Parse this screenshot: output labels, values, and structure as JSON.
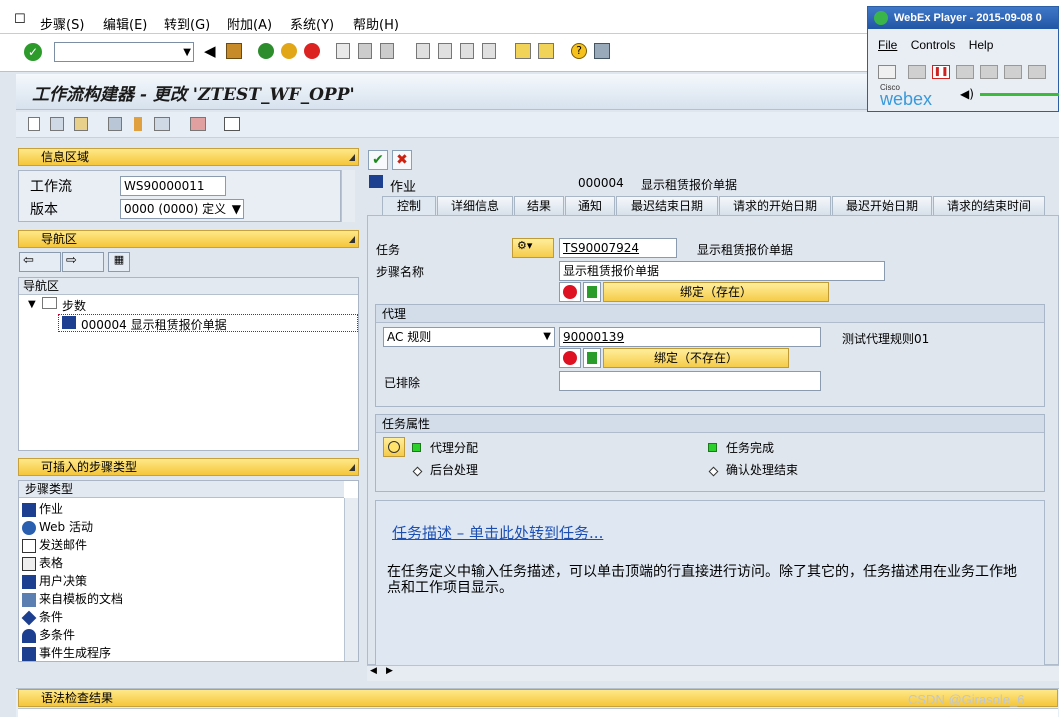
{
  "menu": [
    "步骤(S)",
    "编辑(E)",
    "转到(G)",
    "附加(A)",
    "系统(Y)",
    "帮助(H)"
  ],
  "window_title": "工作流构建器 - 更改 'ZTEST_WF_OPP'",
  "info_area": {
    "header": "信息区域",
    "workflow_label": "工作流",
    "workflow_value": "WS90000011",
    "version_label": "版本",
    "version_value": "0000 (0000) 定义"
  },
  "nav_area": {
    "header": "导航区",
    "column": "导航区",
    "root": "步数",
    "step": "000004 显示租赁报价单据"
  },
  "insert_area": {
    "header": "可插入的步骤类型",
    "column": "步骤类型",
    "items": [
      "作业",
      "Web 活动",
      "发送邮件",
      "表格",
      "用户决策",
      "来自模板的文档",
      "条件",
      "多条件",
      "事件生成程序"
    ]
  },
  "bottom_header": "语法检查结果",
  "step_header": {
    "type": "作业",
    "number": "000004",
    "name": "显示租赁报价单据"
  },
  "tabs": [
    "控制",
    "详细信息",
    "结果",
    "通知",
    "最迟结束日期",
    "请求的开始日期",
    "最迟开始日期",
    "请求的结束时间"
  ],
  "control": {
    "task_label": "任务",
    "task_value": "TS90007924",
    "task_desc": "显示租赁报价单据",
    "stepname_label": "步骤名称",
    "stepname_value": "显示租赁报价单据",
    "binding_exists": "绑定（存在）",
    "agent_group": "代理",
    "agent_type": "AC 规则",
    "agent_value": "90000139",
    "agent_desc": "测试代理规则01",
    "binding_missing": "绑定（不存在）",
    "excluded_label": "已排除",
    "props_group": "任务属性",
    "prop1": "代理分配",
    "prop2": "任务完成",
    "prop3": "后台处理",
    "prop4": "确认处理结束"
  },
  "description": {
    "link": "任务描述 – 单击此处转到任务...",
    "text": "在任务定义中输入任务描述，可以单击顶端的行直接进行访问。除了其它的，任务描述用在业务工作地点和工作项目显示。"
  },
  "webex": {
    "title": "WebEx Player - 2015-09-08 0",
    "menu": [
      "File",
      "Controls",
      "Help"
    ],
    "brand_small": "Cisco",
    "brand": "webex"
  },
  "watermark": "CSDN @Girasole_6",
  "colors": {
    "yellow": "#f4c63b",
    "green": "#2bd02b",
    "link": "#1d4fb2"
  }
}
